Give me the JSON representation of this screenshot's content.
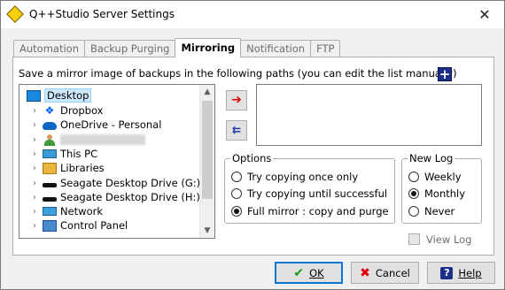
{
  "window": {
    "title": "Q++Studio Server Settings",
    "close_glyph": "✕",
    "app_icon": "qstudio-icon"
  },
  "tabs": [
    {
      "label": "Automation",
      "active": false
    },
    {
      "label": "Backup Purging",
      "active": false
    },
    {
      "label": "Mirroring",
      "active": true
    },
    {
      "label": "Notification",
      "active": false
    },
    {
      "label": "FTP",
      "active": false
    }
  ],
  "mirroring": {
    "instructions": "Save a mirror image of backups in the following paths (you can edit the list manually)",
    "add_path_button": "+",
    "tree": [
      {
        "label": "Desktop",
        "icon": "desktop-icon",
        "selected": true,
        "expander": ""
      },
      {
        "label": "Dropbox",
        "icon": "dropbox-icon",
        "expander": "›"
      },
      {
        "label": "OneDrive - Personal",
        "icon": "onedrive-icon",
        "expander": "›"
      },
      {
        "label": "",
        "icon": "user-icon",
        "expander": "›",
        "blurred": true
      },
      {
        "label": "This PC",
        "icon": "computer-icon",
        "expander": "›"
      },
      {
        "label": "Libraries",
        "icon": "libraries-icon",
        "expander": "›"
      },
      {
        "label": "Seagate Desktop Drive (G:)",
        "icon": "drive-icon",
        "expander": "›"
      },
      {
        "label": "Seagate Desktop Drive (H:)",
        "icon": "drive-icon",
        "expander": "›"
      },
      {
        "label": "Network",
        "icon": "network-icon",
        "expander": "›"
      },
      {
        "label": "Control Panel",
        "icon": "control-panel-icon",
        "expander": "›"
      }
    ],
    "add_arrow_glyph": "➔",
    "remove_arrow_glyph": "⇇",
    "paths": [],
    "options": {
      "title": "Options",
      "items": [
        {
          "label": "Try copying once only",
          "checked": false
        },
        {
          "label": "Try copying until successful",
          "checked": false
        },
        {
          "label": "Full mirror : copy and purge",
          "checked": true
        }
      ]
    },
    "new_log": {
      "title": "New Log",
      "items": [
        {
          "label": "Weekly",
          "checked": false
        },
        {
          "label": "Monthly",
          "checked": true
        },
        {
          "label": "Never",
          "checked": false
        }
      ]
    },
    "view_log": {
      "label": "View Log",
      "checked": false,
      "enabled": false
    }
  },
  "buttons": {
    "ok": {
      "label": "OK",
      "icon_glyph": "✔"
    },
    "cancel": {
      "label": "Cancel",
      "icon_glyph": "✖"
    },
    "help": {
      "label": "Help",
      "icon_glyph": "?"
    }
  },
  "colors": {
    "accent": "#0078d7",
    "add_arrow": "#dd0000",
    "help_blue": "#1a2e8a"
  }
}
